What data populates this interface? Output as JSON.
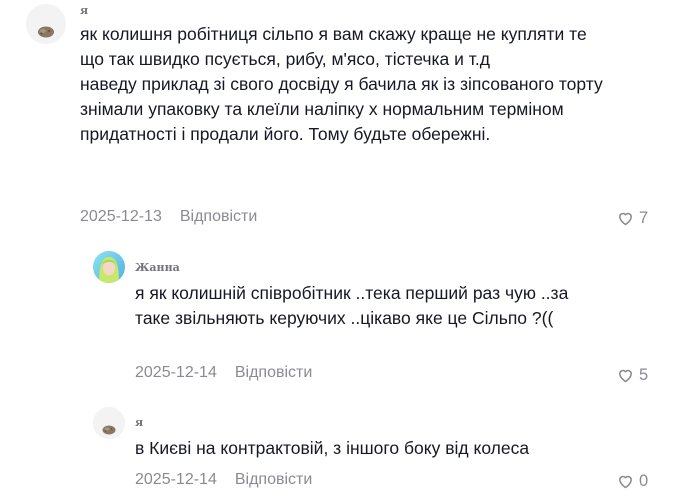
{
  "comments": [
    {
      "author": "я",
      "text": "як колишня робітниця сільпо я вам скажу краще не купляти те що так швидко псується, рибу, м'ясо, тістечка и т.д\nнаведу приклад зі свого досвіду я бачила як із зіпсованого торту знімали упаковку та клеїли наліпку х нормальним терміном придатності і продали його. Тому будьте обережні.",
      "date": "2025-12-13",
      "reply_label": "Відповісти",
      "likes": "7",
      "avatar_icon": "potato-avatar-icon"
    },
    {
      "author": "Жанна",
      "text": "я як колишній співробітник ..тека перший раз чую ..за таке звільняють керуючих ..цікаво яке це Сільпо ?((",
      "date": "2025-12-14",
      "reply_label": "Відповісти",
      "likes": "5",
      "avatar_icon": "girl-avatar-icon"
    },
    {
      "author": "я",
      "text": "в Києві на контрактовій, з іншого боку від колеса",
      "date": "2025-12-14",
      "reply_label": "Відповісти",
      "likes": "0",
      "avatar_icon": "potato-avatar-icon"
    }
  ],
  "colors": {
    "text": "#161823",
    "muted": "#8a8b91"
  }
}
